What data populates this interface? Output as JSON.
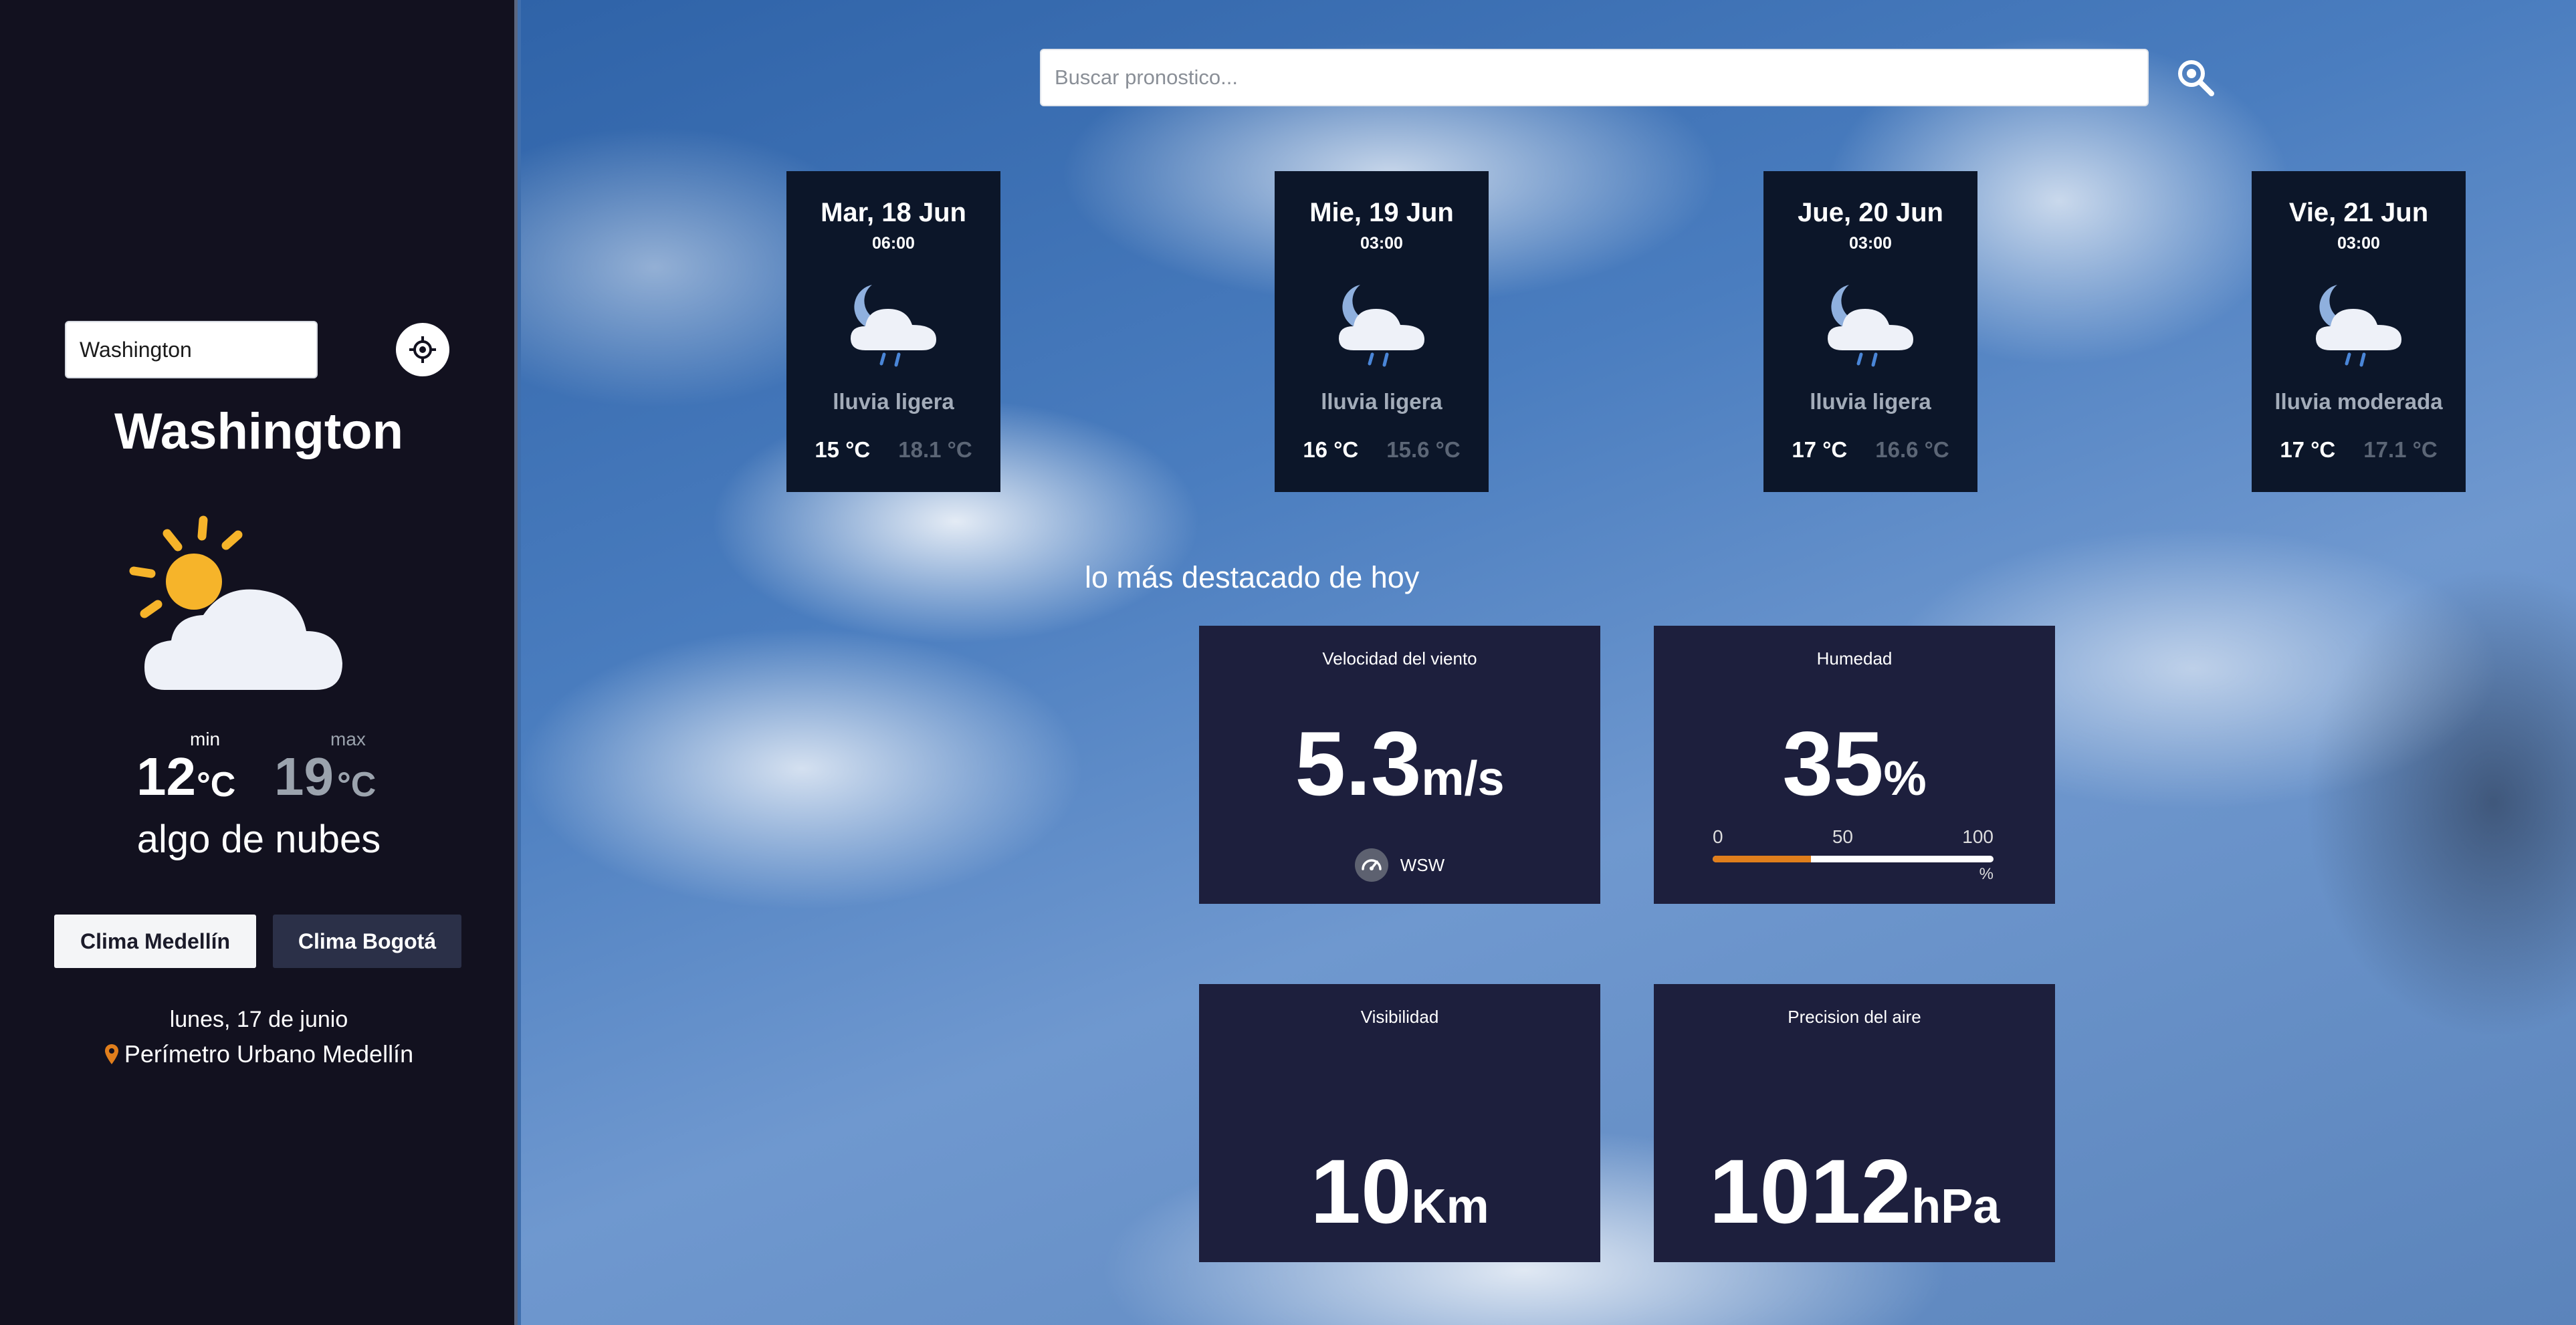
{
  "sidebar": {
    "city_input_value": "Washington",
    "city_name": "Washington",
    "condition": "algo de nubes",
    "temp_min": "12",
    "temp_max": "19",
    "temp_unit": "°C",
    "min_label": "min",
    "max_label": "max",
    "btn_medellin": "Clima Medellín",
    "btn_bogota": "Clima Bogotá",
    "date": "lunes, 17 de junio",
    "location": "Perímetro Urbano Medellín",
    "icons": [
      "crosshair-icon",
      "sun-cloud-icon",
      "location-pin-icon"
    ]
  },
  "search": {
    "placeholder": "Buscar pronostico...",
    "value": "",
    "icon": "search-icon"
  },
  "forecast": [
    {
      "date": "Mar, 18 Jun",
      "time": "06:00",
      "desc": "lluvia ligera",
      "min": "15 °C",
      "max": "18.1 °C"
    },
    {
      "date": "Mie, 19 Jun",
      "time": "03:00",
      "desc": "lluvia ligera",
      "min": "16 °C",
      "max": "15.6 °C"
    },
    {
      "date": "Jue, 20 Jun",
      "time": "03:00",
      "desc": "lluvia ligera",
      "min": "17 °C",
      "max": "16.6 °C"
    },
    {
      "date": "Vie, 21 Jun",
      "time": "03:00",
      "desc": "lluvia moderada",
      "min": "17 °C",
      "max": "17.1 °C"
    }
  ],
  "highlights": {
    "title": "lo más destacado de hoy",
    "wind": {
      "label": "Velocidad del viento",
      "value": "5.3",
      "unit": "m/s",
      "direction": "WSW"
    },
    "humidity": {
      "label": "Humedad",
      "value": "35",
      "unit": "%",
      "scale": [
        "0",
        "50",
        "100"
      ],
      "scale_unit": "%",
      "level_percent": 35
    },
    "visibility": {
      "label": "Visibilidad",
      "value": "10",
      "unit": "Km"
    },
    "pressure": {
      "label": "Precision del aire",
      "value": "1012",
      "unit": "hPa"
    }
  },
  "colors": {
    "sidebar_bg": "#12111f",
    "card_bg": "#0c1629",
    "highlight_bg": "#1d1f3d",
    "accent_orange": "#e07e1c",
    "sun_yellow": "#f6b42a"
  }
}
